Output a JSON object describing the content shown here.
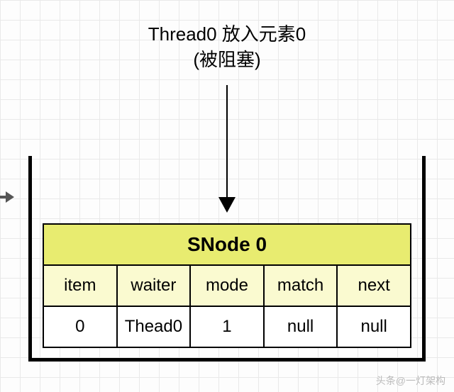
{
  "caption": {
    "line1": "Thread0 放入元素0",
    "line2": "(被阻塞)"
  },
  "node": {
    "title": "SNode 0",
    "fields": {
      "item": {
        "label": "item",
        "value": "0"
      },
      "waiter": {
        "label": "waiter",
        "value": "Thead0"
      },
      "mode": {
        "label": "mode",
        "value": "1"
      },
      "match": {
        "label": "match",
        "value": "null"
      },
      "next": {
        "label": "next",
        "value": "null"
      }
    }
  },
  "watermark": "头条@一灯架构",
  "chart_data": {
    "type": "table",
    "title": "SNode 0",
    "columns": [
      "item",
      "waiter",
      "mode",
      "match",
      "next"
    ],
    "rows": [
      [
        "0",
        "Thead0",
        "1",
        "null",
        "null"
      ]
    ],
    "caption": "Thread0 放入元素0 (被阻塞)"
  }
}
